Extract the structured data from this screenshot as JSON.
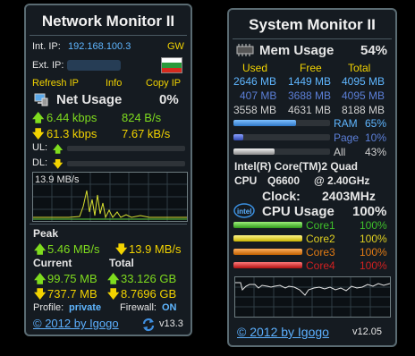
{
  "net": {
    "title": "Network Monitor II",
    "int_ip_label": "Int. IP:",
    "int_ip": "192.168.100.3",
    "gw": "GW",
    "ext_ip_label": "Ext. IP:",
    "refresh": "Refresh IP",
    "info": "Info",
    "copy": "Copy IP",
    "usage_label": "Net Usage",
    "usage_pct": "0%",
    "up_kbps": "6.44 kbps",
    "up_bs": "824 B/s",
    "down_kbps": "61.3 kbps",
    "down_kbs": "7.67 kB/s",
    "ul_label": "UL:",
    "dl_label": "DL:",
    "graph_label": "13.9 MB/s",
    "peak_label": "Peak",
    "peak_up": "5.46 MB/s",
    "peak_down": "13.9 MB/s",
    "current_label": "Current",
    "total_label": "Total",
    "cur_up": "99.75 MB",
    "tot_up": "33.126 GB",
    "cur_down": "737.7 MB",
    "tot_down": "8.7696 GB",
    "profile_label": "Profile:",
    "profile_value": "private",
    "firewall_label": "Firewall:",
    "firewall_value": "ON",
    "footer_link": "© 2012 by Igogo",
    "version": "v13.3"
  },
  "sys": {
    "title": "System Monitor II",
    "mem_label": "Mem Usage",
    "mem_pct": "54%",
    "col_used": "Used",
    "col_free": "Free",
    "col_total": "Total",
    "mem_rows": [
      {
        "used": "2646 MB",
        "free": "1449 MB",
        "total": "4095 MB"
      },
      {
        "used": "407 MB",
        "free": "3688 MB",
        "total": "4095 MB"
      },
      {
        "used": "3558 MB",
        "free": "4631 MB",
        "total": "8188 MB"
      }
    ],
    "bars": [
      {
        "label": "RAM",
        "pct": "65%",
        "fill": 0.65
      },
      {
        "label": "Page",
        "pct": "10%",
        "fill": 0.1
      },
      {
        "label": "All",
        "pct": "43%",
        "fill": 0.43
      }
    ],
    "cpu_name": "Intel(R) Core(TM)2 Quad",
    "cpu_line2_a": "CPU",
    "cpu_line2_b": "Q6600",
    "cpu_line2_c": "@ 2.40GHz",
    "clock_label": "Clock:",
    "clock_value": "2403MHz",
    "cpu_usage_label": "CPU Usage",
    "cpu_usage_pct": "100%",
    "cores": [
      {
        "label": "Core1",
        "pct": "100%",
        "color": "#3fbf2a",
        "fill": 1.0
      },
      {
        "label": "Core2",
        "pct": "100%",
        "color": "#e0d020",
        "fill": 1.0
      },
      {
        "label": "Core3",
        "pct": "100%",
        "color": "#e07a14",
        "fill": 1.0
      },
      {
        "label": "Core4",
        "pct": "100%",
        "color": "#d02020",
        "fill": 1.0
      }
    ],
    "footer_link": "© 2012 by Igogo",
    "version": "v12.05"
  }
}
